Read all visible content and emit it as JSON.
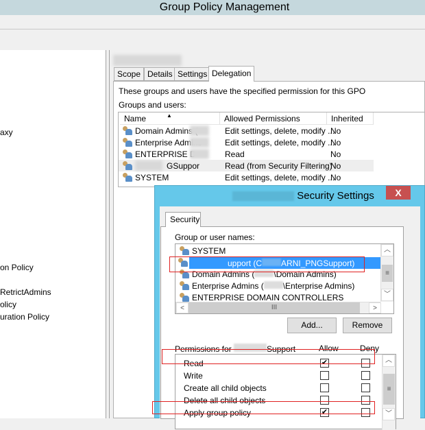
{
  "window": {
    "title": "Group Policy Management"
  },
  "tree": {
    "items": [
      "axy",
      "on Policy",
      "RetrictAdmins",
      "olicy",
      "uration Policy"
    ]
  },
  "gpo": {
    "tabs": [
      "Scope",
      "Details",
      "Settings",
      "Delegation"
    ],
    "active_tab": "Delegation",
    "description": "These groups and users have the specified permission for this GPO",
    "groups_label": "Groups and users:",
    "columns": [
      "Name",
      "Allowed Permissions",
      "Inherited"
    ],
    "rows": [
      {
        "name": "Domain Admins (",
        "perm": "Edit settings, delete, modify ...",
        "inherited": "No"
      },
      {
        "name": "Enterprise Admins",
        "perm": "Edit settings, delete, modify ...",
        "inherited": "No"
      },
      {
        "name": "ENTERPRISE D",
        "perm": "Read",
        "inherited": "No"
      },
      {
        "name": "GSuppor",
        "perm": "Read (from Security Filtering)",
        "inherited": "No"
      },
      {
        "name": "SYSTEM",
        "perm": "Edit settings, delete, modify ...",
        "inherited": "No"
      }
    ]
  },
  "dialog": {
    "title": "Security Settings",
    "close": "X",
    "tab": "Security",
    "group_label": "Group or user names:",
    "names": [
      "SYSTEM",
      "upport (C",
      "Domain Admins (",
      "Enterprise Admins (",
      "ENTERPRISE DOMAIN CONTROLLERS"
    ],
    "names_suffix": [
      "",
      "ARNI_PNGSupport)",
      "\\Domain Admins)",
      "\\Enterprise Admins)",
      ""
    ],
    "selected_index": 1,
    "add": "Add...",
    "remove": "Remove",
    "perm_label_prefix": "Permissions for",
    "perm_label_suffix": "Support",
    "allow": "Allow",
    "deny": "Deny",
    "permissions": [
      {
        "name": "Read",
        "allow": true,
        "deny": false
      },
      {
        "name": "Write",
        "allow": false,
        "deny": false
      },
      {
        "name": "Create all child objects",
        "allow": false,
        "deny": false
      },
      {
        "name": "Delete all child objects",
        "allow": false,
        "deny": false
      },
      {
        "name": "Apply group policy",
        "allow": true,
        "deny": false
      }
    ],
    "scroll_glyph": "III"
  },
  "colors": {
    "dialog_frame": "#65c8ea",
    "selection": "#3399ff",
    "highlight_box": "#e02020",
    "close": "#c75050"
  }
}
